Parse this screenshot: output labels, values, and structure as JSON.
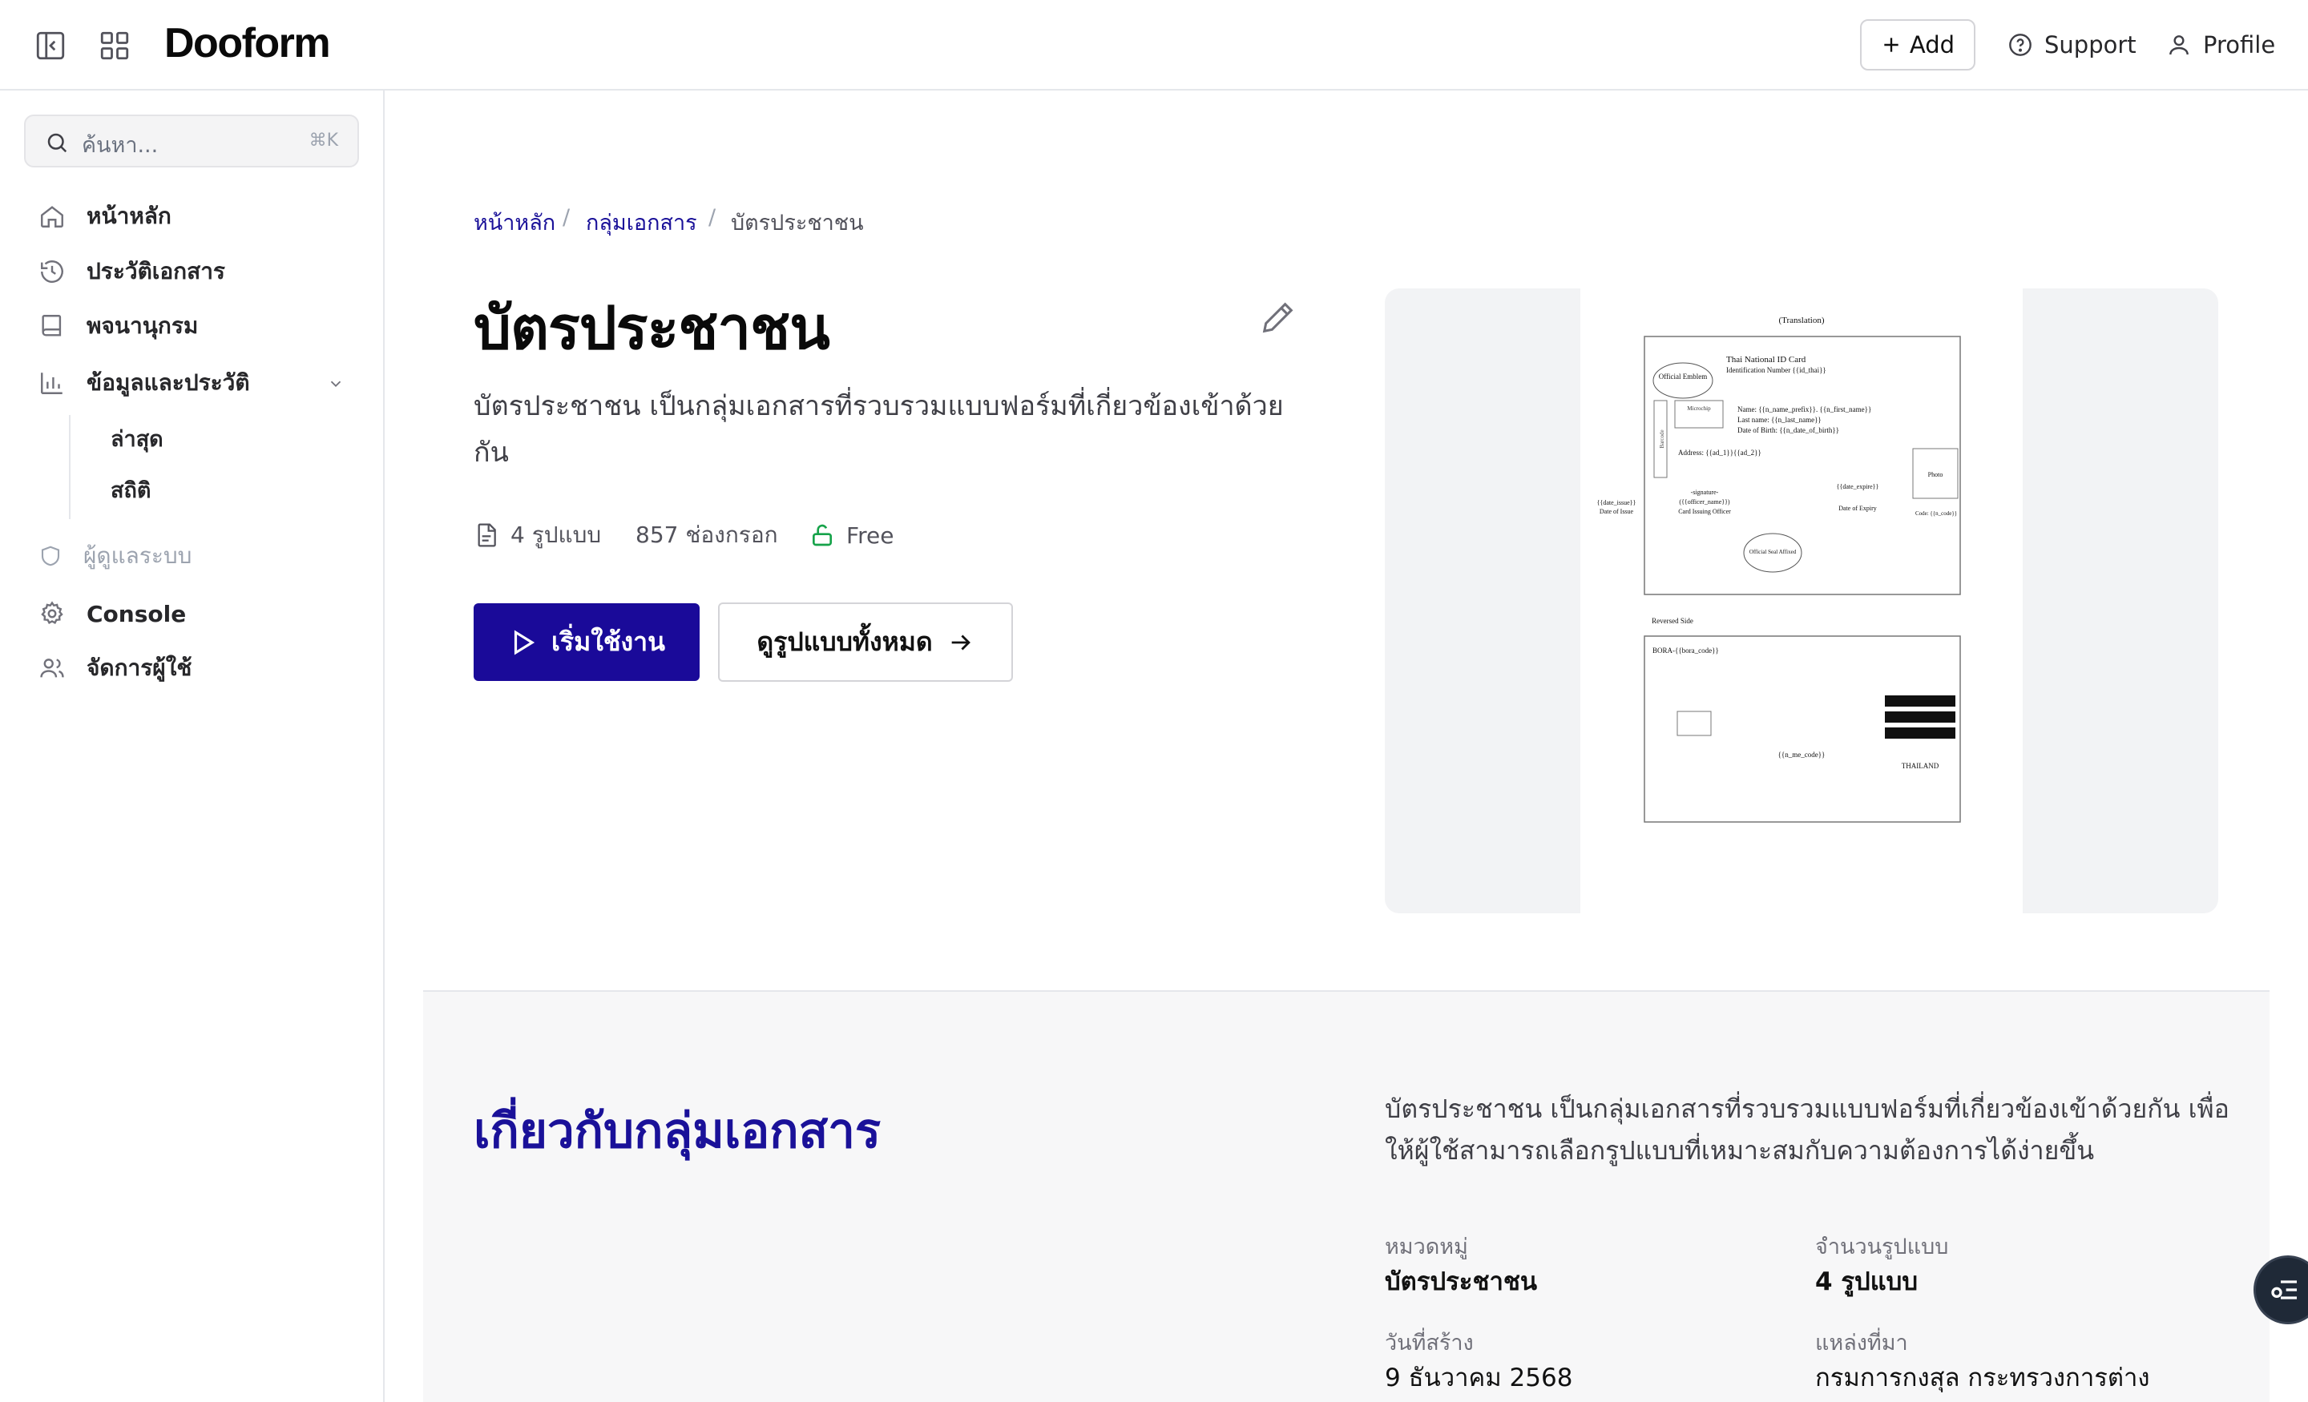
{
  "app": {
    "logo": "Dooform"
  },
  "header": {
    "add_label": "Add",
    "support_label": "Support",
    "profile_label": "Profile"
  },
  "sidebar": {
    "search": {
      "placeholder": "ค้นหา...",
      "shortcut": "⌘K"
    },
    "items": [
      {
        "label": "หน้าหลัก",
        "icon": "home-icon"
      },
      {
        "label": "ประวัติเอกสาร",
        "icon": "history-icon"
      },
      {
        "label": "พจนานุกรม",
        "icon": "book-icon"
      },
      {
        "label": "ข้อมูลและประวัติ",
        "icon": "bar-chart-icon",
        "subitems": [
          {
            "label": "ล่าสุด"
          },
          {
            "label": "สถิติ"
          }
        ]
      },
      {
        "label": "ผู้ดูแลระบบ",
        "icon": "shield-icon"
      },
      {
        "label": "Console",
        "icon": "gear-icon"
      },
      {
        "label": "จัดการผู้ใช้",
        "icon": "users-icon"
      }
    ]
  },
  "breadcrumb": [
    "หน้าหลัก",
    "/",
    "กลุ่มเอกสาร",
    "/",
    "บัตรประชาชน"
  ],
  "main": {
    "title": "บัตรประชาชน",
    "description": "บัตรประชาชน เป็นกลุ่มเอกสารที่รวบรวมแบบฟอร์มที่เกี่ยวข้องเข้าด้วยกัน",
    "meta": {
      "templates": "4 รูปแบบ",
      "fields": "857 ช่องกรอก",
      "access": "Free"
    },
    "start_button": "เริ่มใช้งาน",
    "view_all_button": "ดูรูปแบบทั้งหมด"
  },
  "preview": {
    "heading": "(Translation)",
    "card_title": "Thai National ID Card",
    "id_line": "Identification Number {{id_thai}}",
    "emblem": "Official Emblem",
    "microchip": "Microchip",
    "name_line": "Name: {{n_name_prefix}}. {{n_first_name}}",
    "last_line": "Last name: {{n_last_name}}",
    "dob_line": "Date of Birth: {{n_date_of_birth}}",
    "address_line": "Address: {{ad_1}}{{ad_2}}",
    "photo": "Photo",
    "date_expire": "{{date_expire}}",
    "date_issue": "{{date_issue}}",
    "date_issue_label": "Date of Issue",
    "signature": "-signature-",
    "officer_name": "({{officer_name}})",
    "officer_label": "Card Issuing Officer",
    "expiry_label": "Date of Expiry",
    "code_line": "Code: {{n_code}}",
    "seal": "Official Seal Affixed",
    "reversed": "Reversed Side",
    "bora": "BORA-{{bora_code}}",
    "me_code": "{{n_me_code}}",
    "country": "THAILAND",
    "side_text": "Barcode"
  },
  "about": {
    "title": "เกี่ยวกับกลุ่มเอกสาร",
    "description": "บัตรประชาชน เป็นกลุ่มเอกสารที่รวบรวมแบบฟอร์มที่เกี่ยวข้องเข้าด้วยกัน เพื่อให้ผู้ใช้สามารถเลือกรูปแบบที่เหมาะสมกับความต้องการได้ง่ายขึ้น",
    "category_label": "หมวดหมู่",
    "category_value": "บัตรประชาชน",
    "count_label": "จำนวนรูปแบบ",
    "count_value": "4 รูปแบบ",
    "created_label": "วันที่สร้าง",
    "created_value": "9 ธันวาคม 2568",
    "source_label": "แหล่งที่มา",
    "source_value": "กรมการกงสุล กระทรวงการต่าง"
  },
  "colors": {
    "brand": "#1a0a99",
    "link": "#1a1199",
    "free": "#16a34a"
  }
}
